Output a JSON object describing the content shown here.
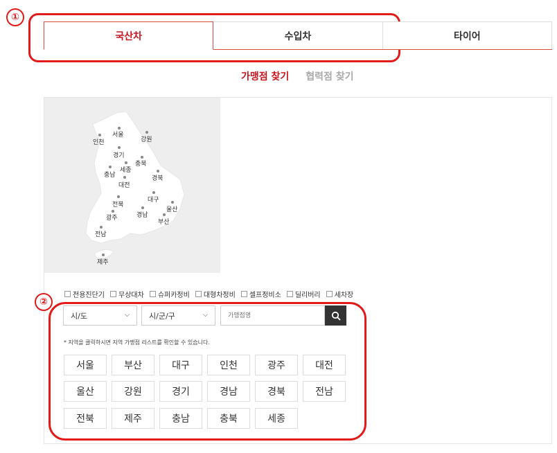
{
  "annotations": {
    "one": "①",
    "two": "②"
  },
  "tabs": [
    {
      "label": "국산차",
      "active": true
    },
    {
      "label": "수입차",
      "active": false
    },
    {
      "label": "타이어",
      "active": false
    }
  ],
  "subtabs": [
    {
      "label": "가맹점 찾기",
      "active": true
    },
    {
      "label": "협력점 찾기",
      "active": false
    }
  ],
  "map_labels": [
    "인천",
    "서울",
    "강원",
    "경기",
    "충북",
    "세종",
    "충남",
    "대전",
    "경북",
    "전북",
    "대구",
    "울산",
    "광주",
    "경남",
    "부산",
    "전남",
    "제주"
  ],
  "checkboxes": [
    "전용진단기",
    "무상대차",
    "슈퍼카정비",
    "대형차정비",
    "셀프정비소",
    "딜리버리",
    "세차장"
  ],
  "filters": {
    "sido": "시/도",
    "sigungu": "시/군/구",
    "store_placeholder": "가맹점명"
  },
  "hint": "* 지역을 클릭하시면 지역 가맹점 리스트를 확인할 수 있습니다.",
  "regions": [
    "서울",
    "부산",
    "대구",
    "인천",
    "광주",
    "대전",
    "울산",
    "강원",
    "경기",
    "경남",
    "경북",
    "전남",
    "전북",
    "제주",
    "충남",
    "충북",
    "세종"
  ],
  "colors": {
    "accent": "#c8161d",
    "annotation": "#e21a1a"
  }
}
